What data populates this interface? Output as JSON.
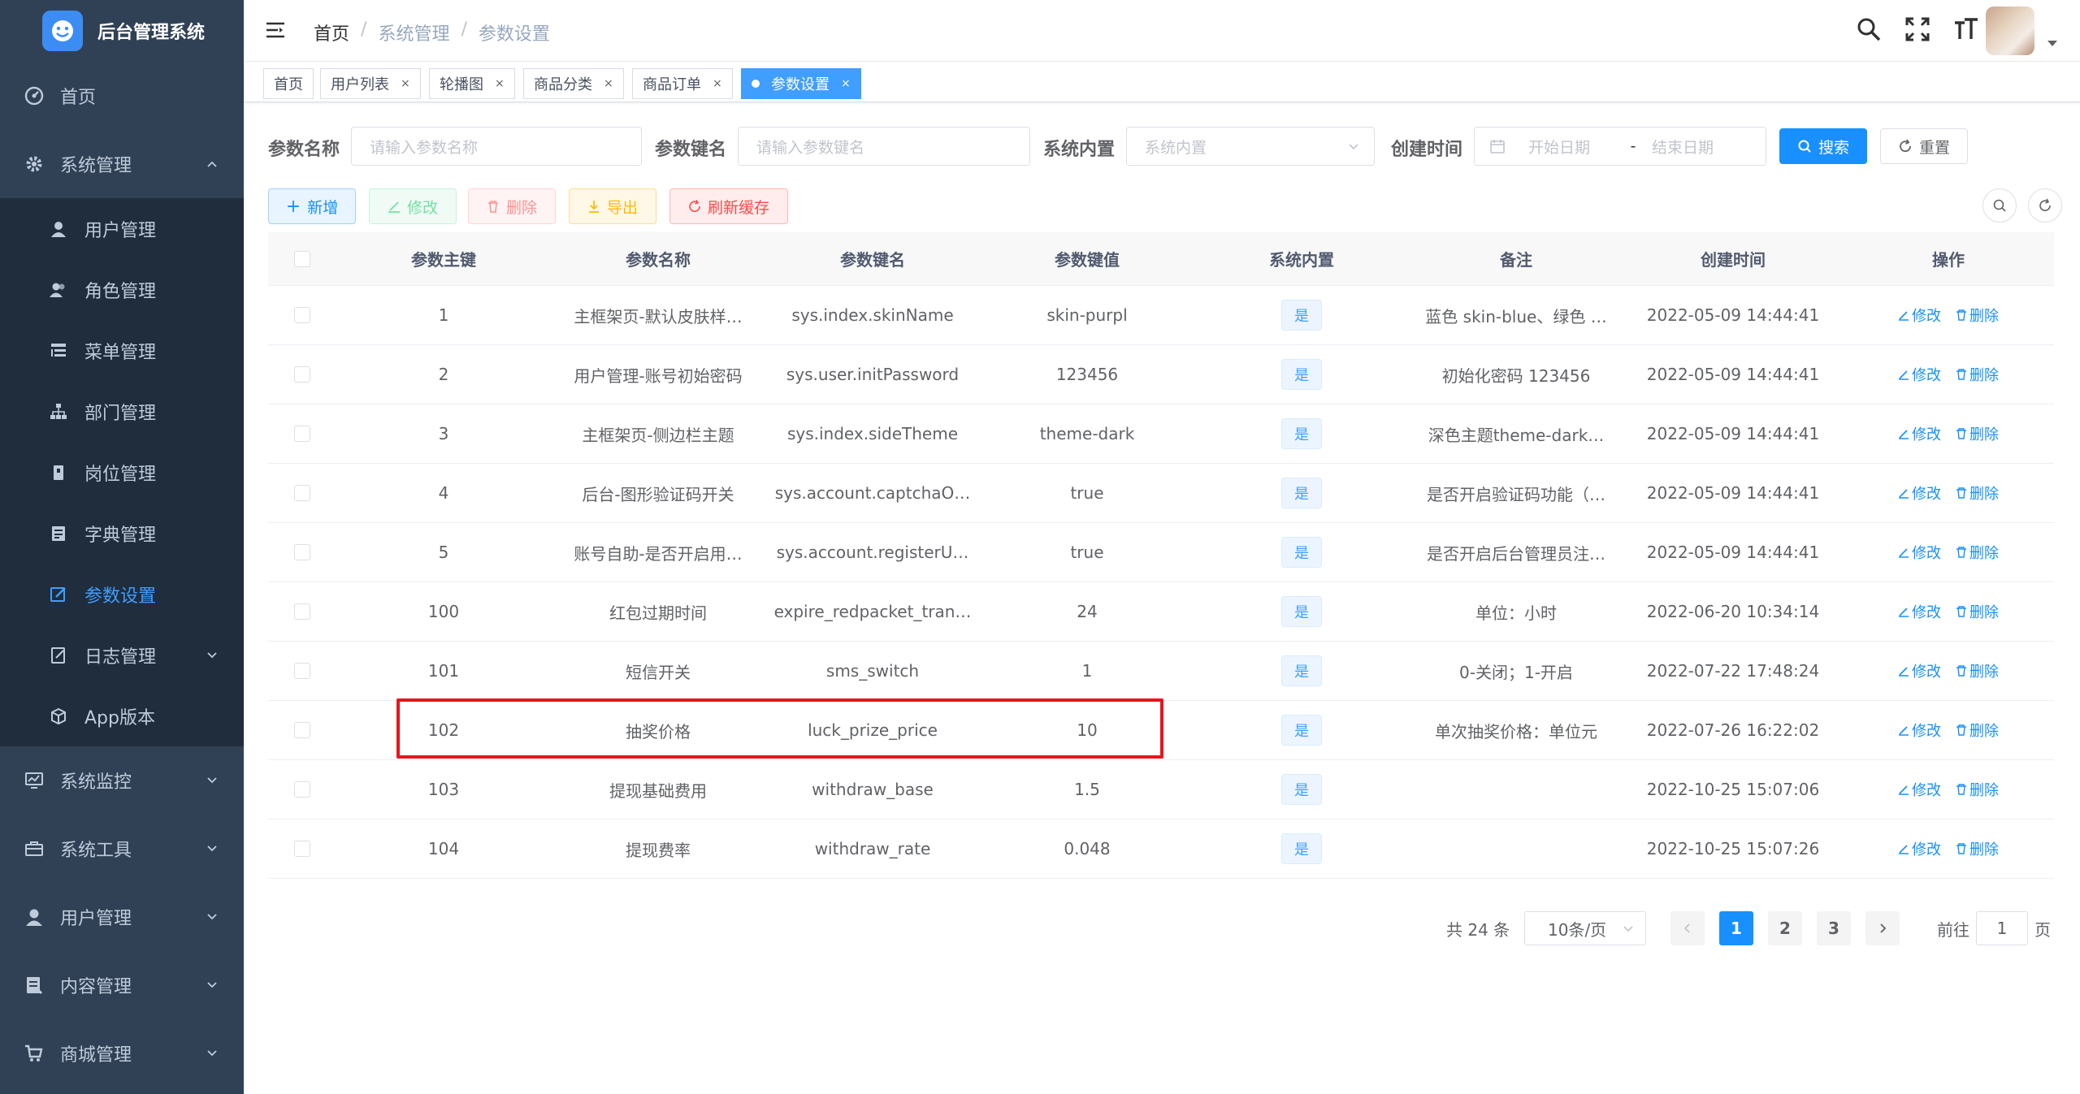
{
  "app": {
    "title": "后台管理系统"
  },
  "sidebar": {
    "items": [
      {
        "label": "首页",
        "icon": "dashboard-icon"
      },
      {
        "label": "系统管理",
        "icon": "gear-icon",
        "expanded": true,
        "children": [
          {
            "label": "用户管理",
            "icon": "user-icon"
          },
          {
            "label": "角色管理",
            "icon": "peoples-icon"
          },
          {
            "label": "菜单管理",
            "icon": "tree-table-icon"
          },
          {
            "label": "部门管理",
            "icon": "org-tree-icon"
          },
          {
            "label": "岗位管理",
            "icon": "post-icon"
          },
          {
            "label": "字典管理",
            "icon": "dict-icon"
          },
          {
            "label": "参数设置",
            "icon": "edit-icon",
            "active": true
          },
          {
            "label": "日志管理",
            "icon": "log-icon"
          },
          {
            "label": "App版本",
            "icon": "package-icon"
          }
        ]
      },
      {
        "label": "系统监控",
        "icon": "monitor-icon"
      },
      {
        "label": "系统工具",
        "icon": "toolbox-icon"
      },
      {
        "label": "用户管理",
        "icon": "user-icon"
      },
      {
        "label": "内容管理",
        "icon": "content-icon"
      },
      {
        "label": "商城管理",
        "icon": "cart-icon"
      }
    ]
  },
  "header": {
    "breadcrumb": [
      "首页",
      "系统管理",
      "参数设置"
    ],
    "separator": "/"
  },
  "tags": [
    {
      "label": "首页",
      "closable": false
    },
    {
      "label": "用户列表",
      "closable": true
    },
    {
      "label": "轮播图",
      "closable": true
    },
    {
      "label": "商品分类",
      "closable": true
    },
    {
      "label": "商品订单",
      "closable": true
    },
    {
      "label": "参数设置",
      "closable": true,
      "active": true
    }
  ],
  "tag_close": "×",
  "search": {
    "config_name_label": "参数名称",
    "config_name_placeholder": "请输入参数名称",
    "config_key_label": "参数键名",
    "config_key_placeholder": "请输入参数键名",
    "config_type_label": "系统内置",
    "config_type_placeholder": "系统内置",
    "create_time_label": "创建时间",
    "start_placeholder": "开始日期",
    "range_sep": "-",
    "end_placeholder": "结束日期",
    "search_btn": "搜索",
    "reset_btn": "重置"
  },
  "toolbar": {
    "add": "新增",
    "edit": "修改",
    "delete": "删除",
    "export": "导出",
    "refresh_cache": "刷新缓存"
  },
  "table": {
    "columns": [
      "参数主键",
      "参数名称",
      "参数键名",
      "参数键值",
      "系统内置",
      "备注",
      "创建时间",
      "操作"
    ],
    "rows": [
      {
        "id": "1",
        "name": "主框架页-默认皮肤样…",
        "key": "sys.index.skinName",
        "value": "skin-purpl",
        "builtin": "是",
        "remark": "蓝色 skin-blue、绿色 …",
        "time": "2022-05-09 14:44:41"
      },
      {
        "id": "2",
        "name": "用户管理-账号初始密码",
        "key": "sys.user.initPassword",
        "value": "123456",
        "builtin": "是",
        "remark": "初始化密码 123456",
        "time": "2022-05-09 14:44:41"
      },
      {
        "id": "3",
        "name": "主框架页-侧边栏主题",
        "key": "sys.index.sideTheme",
        "value": "theme-dark",
        "builtin": "是",
        "remark": "深色主题theme-dark…",
        "time": "2022-05-09 14:44:41"
      },
      {
        "id": "4",
        "name": "后台-图形验证码开关",
        "key": "sys.account.captchaO…",
        "value": "true",
        "builtin": "是",
        "remark": "是否开启验证码功能（…",
        "time": "2022-05-09 14:44:41"
      },
      {
        "id": "5",
        "name": "账号自助-是否开启用…",
        "key": "sys.account.registerU…",
        "value": "true",
        "builtin": "是",
        "remark": "是否开启后台管理员注…",
        "time": "2022-05-09 14:44:41"
      },
      {
        "id": "100",
        "name": "红包过期时间",
        "key": "expire_redpacket_tran…",
        "value": "24",
        "builtin": "是",
        "remark": "单位：小时",
        "time": "2022-06-20 10:34:14"
      },
      {
        "id": "101",
        "name": "短信开关",
        "key": "sms_switch",
        "value": "1",
        "builtin": "是",
        "remark": "0-关闭；1-开启",
        "time": "2022-07-22 17:48:24"
      },
      {
        "id": "102",
        "name": "抽奖价格",
        "key": "luck_prize_price",
        "value": "10",
        "builtin": "是",
        "remark": "单次抽奖价格：单位元",
        "time": "2022-07-26 16:22:02",
        "highlighted": true
      },
      {
        "id": "103",
        "name": "提现基础费用",
        "key": "withdraw_base",
        "value": "1.5",
        "builtin": "是",
        "remark": "",
        "time": "2022-10-25 15:07:06"
      },
      {
        "id": "104",
        "name": "提现费率",
        "key": "withdraw_rate",
        "value": "0.048",
        "builtin": "是",
        "remark": "",
        "time": "2022-10-25 15:07:26"
      }
    ],
    "row_edit": "修改",
    "row_delete": "删除"
  },
  "pagination": {
    "total_text": "共 24 条",
    "page_size": "10条/页",
    "pages": [
      "1",
      "2",
      "3"
    ],
    "current": "1",
    "goto_prefix": "前往",
    "goto_value": "1",
    "goto_suffix": "页"
  },
  "colors": {
    "sidebar_bg": "#304156",
    "submenu_bg": "#1f2d3d",
    "primary": "#1890ff",
    "highlight_box": "#e8141c"
  }
}
